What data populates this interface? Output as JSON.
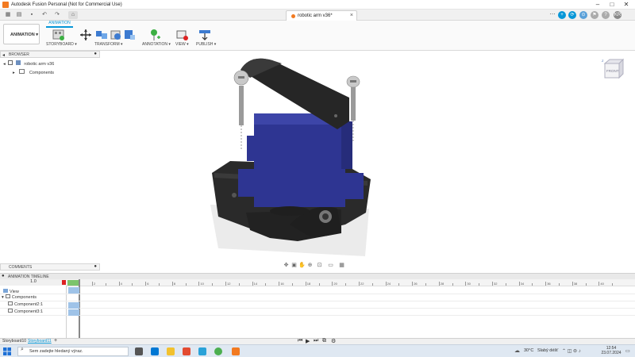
{
  "window": {
    "title": "Autodesk Fusion Personal (Not for Commercial Use)",
    "document_tab": "robotic arm v36*",
    "user_initials": "KR"
  },
  "toolbar": {
    "workspace": "ANIMATION",
    "workspace_tab": "ANIMATION",
    "groups": {
      "storyboard": "STORYBOARD",
      "transform": "TRANSFORM",
      "annotation": "ANNOTATION",
      "view": "VIEW",
      "publish": "PUBLISH"
    }
  },
  "browser": {
    "label": "BROWSER",
    "root": "robotic arm v36",
    "items": [
      "Components"
    ]
  },
  "viewcube": {
    "face": "FRONT",
    "axis": "Z"
  },
  "comments": {
    "label": "COMMENTS"
  },
  "timeline": {
    "label": "ANIMATION TIMELINE",
    "speed": "1.0",
    "rows": [
      "View",
      "Components",
      "Component2:1",
      "Component3:1"
    ],
    "ticks": [
      "2",
      "4",
      "6",
      "8",
      "10",
      "12",
      "14",
      "16",
      "18",
      "20",
      "22",
      "24",
      "26",
      "28",
      "30",
      "32",
      "34",
      "36",
      "38",
      "40"
    ]
  },
  "storyboards": {
    "tabs": [
      "Storyboard10",
      "Storyboard11"
    ],
    "add": "+"
  },
  "taskbar": {
    "search_placeholder": "Sem zadejte hledaný výraz.",
    "temperature": "30°C",
    "weather": "Slabý déšť",
    "time": "12:54",
    "date": "23.07.2024"
  },
  "colors": {
    "accent": "#0696d7",
    "fusion_orange": "#f27a21",
    "servo_blue": "#2e3592",
    "part_dark": "#2b2b2b",
    "keyframe": "#9fc3e8"
  }
}
